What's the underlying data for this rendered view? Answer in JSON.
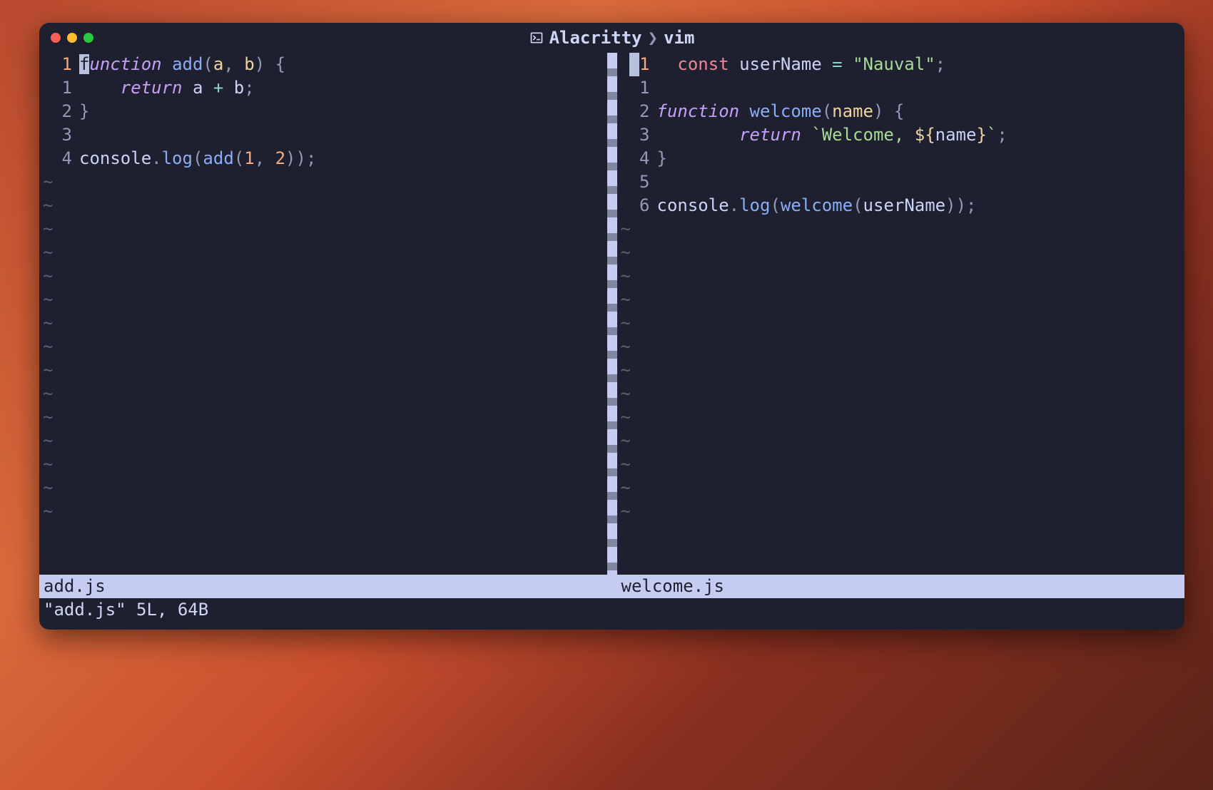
{
  "window": {
    "title_app": "Alacritty",
    "title_sep": "❯",
    "title_process": "vim"
  },
  "left": {
    "lines": [
      {
        "num": "1",
        "current": true,
        "tokens": [
          {
            "type": "cursor",
            "text": "f"
          },
          {
            "type": "kw",
            "text": "unction"
          },
          {
            "type": "txt",
            "text": " "
          },
          {
            "type": "fn",
            "text": "add"
          },
          {
            "type": "punc",
            "text": "("
          },
          {
            "type": "param",
            "text": "a"
          },
          {
            "type": "punc",
            "text": ", "
          },
          {
            "type": "param",
            "text": "b"
          },
          {
            "type": "punc",
            "text": ") "
          },
          {
            "type": "brace",
            "text": "{"
          }
        ]
      },
      {
        "num": "1",
        "current": false,
        "indent": "    ",
        "tokens": [
          {
            "type": "ret",
            "text": "return"
          },
          {
            "type": "txt",
            "text": " a "
          },
          {
            "type": "op",
            "text": "+"
          },
          {
            "type": "txt",
            "text": " b"
          },
          {
            "type": "punc",
            "text": ";"
          }
        ]
      },
      {
        "num": "2",
        "current": false,
        "tokens": [
          {
            "type": "brace",
            "text": "}"
          }
        ]
      },
      {
        "num": "3",
        "current": false,
        "tokens": []
      },
      {
        "num": "4",
        "current": false,
        "tokens": [
          {
            "type": "txt",
            "text": "console"
          },
          {
            "type": "punc",
            "text": "."
          },
          {
            "type": "call",
            "text": "log"
          },
          {
            "type": "punc",
            "text": "("
          },
          {
            "type": "call",
            "text": "add"
          },
          {
            "type": "punc",
            "text": "("
          },
          {
            "type": "num",
            "text": "1"
          },
          {
            "type": "punc",
            "text": ", "
          },
          {
            "type": "num",
            "text": "2"
          },
          {
            "type": "punc",
            "text": "));"
          }
        ]
      }
    ],
    "tilde_count": 15,
    "status": "add.js"
  },
  "right": {
    "lines": [
      {
        "num": "1",
        "current": true,
        "indent": "  ",
        "tokens": [
          {
            "type": "kw2",
            "text": "const"
          },
          {
            "type": "txt",
            "text": " userName "
          },
          {
            "type": "op",
            "text": "="
          },
          {
            "type": "txt",
            "text": " "
          },
          {
            "type": "str",
            "text": "\"Nauval\""
          },
          {
            "type": "punc",
            "text": ";"
          }
        ]
      },
      {
        "num": "1",
        "current": false,
        "tokens": []
      },
      {
        "num": "2",
        "current": false,
        "tokens": [
          {
            "type": "kw",
            "text": "function"
          },
          {
            "type": "txt",
            "text": " "
          },
          {
            "type": "fn",
            "text": "welcome"
          },
          {
            "type": "punc",
            "text": "("
          },
          {
            "type": "param",
            "text": "name"
          },
          {
            "type": "punc",
            "text": ") "
          },
          {
            "type": "brace",
            "text": "{"
          }
        ]
      },
      {
        "num": "3",
        "current": false,
        "indent": "        ",
        "tokens": [
          {
            "type": "ret",
            "text": "return"
          },
          {
            "type": "txt",
            "text": " "
          },
          {
            "type": "str",
            "text": "`Welcome, "
          },
          {
            "type": "tmpl",
            "text": "${"
          },
          {
            "type": "txt",
            "text": "name"
          },
          {
            "type": "tmpl",
            "text": "}"
          },
          {
            "type": "str",
            "text": "`"
          },
          {
            "type": "punc",
            "text": ";"
          }
        ]
      },
      {
        "num": "4",
        "current": false,
        "tokens": [
          {
            "type": "brace",
            "text": "}"
          }
        ]
      },
      {
        "num": "5",
        "current": false,
        "tokens": []
      },
      {
        "num": "6",
        "current": false,
        "tokens": [
          {
            "type": "txt",
            "text": "console"
          },
          {
            "type": "punc",
            "text": "."
          },
          {
            "type": "call",
            "text": "log"
          },
          {
            "type": "punc",
            "text": "("
          },
          {
            "type": "call",
            "text": "welcome"
          },
          {
            "type": "punc",
            "text": "("
          },
          {
            "type": "txt",
            "text": "userName"
          },
          {
            "type": "punc",
            "text": "));"
          }
        ]
      }
    ],
    "tilde_count": 13,
    "status": "welcome.js",
    "cursor_on_gutter": true
  },
  "command_line": "\"add.js\" 5L, 64B"
}
